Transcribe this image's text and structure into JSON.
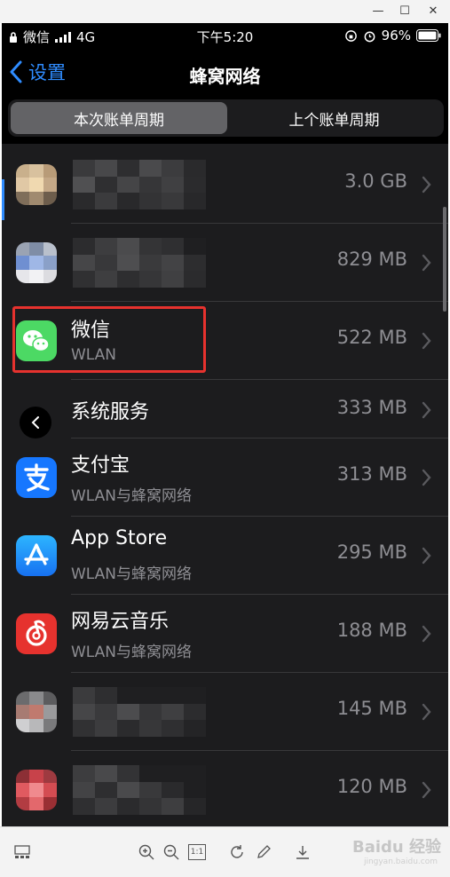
{
  "window": {
    "minimize_glyph": "—",
    "maximize_glyph": "☐",
    "close_glyph": "✕"
  },
  "status_bar": {
    "carrier": "微信",
    "network": "4G",
    "time": "下午5:20",
    "battery": "96%"
  },
  "nav": {
    "back_label": "设置",
    "title": "蜂窝网络"
  },
  "segment": {
    "current": "本次账单周期",
    "previous": "上个账单周期"
  },
  "apps": [
    {
      "name": "",
      "subtitle": "",
      "size": "3.0 GB",
      "icon": "blurred-app-icon"
    },
    {
      "name": "",
      "subtitle": "",
      "size": "829 MB",
      "icon": "blurred-app-icon"
    },
    {
      "name": "微信",
      "subtitle": "WLAN",
      "size": "522 MB",
      "icon": "wechat-icon"
    },
    {
      "name": "系统服务",
      "subtitle": "",
      "size": "333 MB",
      "icon": ""
    },
    {
      "name": "支付宝",
      "subtitle": "WLAN与蜂窝网络",
      "size": "313 MB",
      "icon": "alipay-icon"
    },
    {
      "name": "App Store",
      "subtitle": "WLAN与蜂窝网络",
      "size": "295 MB",
      "icon": "app-store-icon"
    },
    {
      "name": "网易云音乐",
      "subtitle": "WLAN与蜂窝网络",
      "size": "188 MB",
      "icon": "netease-music-icon"
    },
    {
      "name": "",
      "subtitle": "",
      "size": "145 MB",
      "icon": "blurred-app-icon"
    },
    {
      "name": "",
      "subtitle": "",
      "size": "120 MB",
      "icon": "blurred-app-icon"
    }
  ],
  "toolbar": {
    "actual_size": "1:1"
  },
  "watermark": {
    "brand": "Baidu 经验",
    "url": "jingyan.baidu.com"
  },
  "colors": {
    "accent": "#2f8cff",
    "highlight": "#e6322e",
    "wechat": "#4cd964",
    "alipay": "#1677ff",
    "netease": "#e6322e"
  }
}
